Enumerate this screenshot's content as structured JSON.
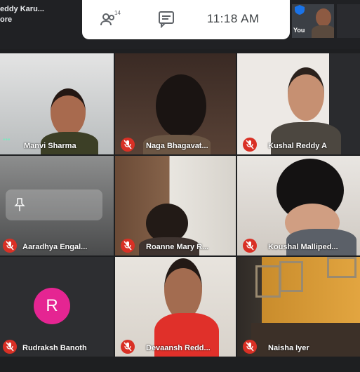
{
  "presenter": {
    "line1": "eddy Karu...",
    "line2": "ore"
  },
  "toolbar": {
    "participant_count": "14",
    "clock": "11:18 AM"
  },
  "self_view": {
    "label": "You"
  },
  "participants": [
    {
      "name": "Manvi Sharma"
    },
    {
      "name": "Naga Bhagavat..."
    },
    {
      "name": "Kushal Reddy A"
    },
    {
      "name": "Aaradhya Engal..."
    },
    {
      "name": "Roanne Mary R..."
    },
    {
      "name": "Koushal Malliped..."
    },
    {
      "name": "Rudraksh Banoth",
      "avatar_letter": "R",
      "avatar_color": "#e52592"
    },
    {
      "name": "Devaansh Redd..."
    },
    {
      "name": "Naisha Iyer"
    }
  ],
  "colors": {
    "mic_muted": "#d93025",
    "background": "#202124"
  }
}
